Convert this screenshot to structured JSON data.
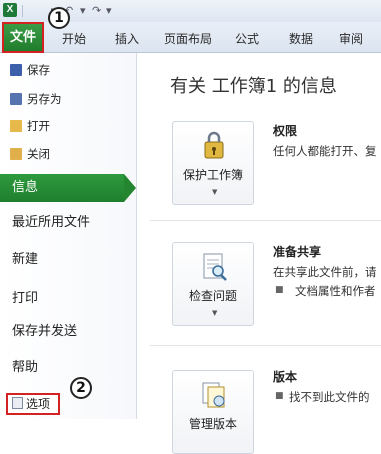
{
  "titlebar": {
    "app_icon_letter": "X",
    "qat_save": "▪",
    "qat_undo": "↶",
    "qat_redo": "↷",
    "qat_more": "▾"
  },
  "ribbon": {
    "file_tab": "文件",
    "tabs": [
      "开始",
      "插入",
      "页面布局",
      "公式",
      "数据",
      "审阅"
    ]
  },
  "callouts": [
    "1",
    "2"
  ],
  "nav": {
    "small_items": [
      "保存",
      "另存为",
      "打开",
      "关闭"
    ],
    "selected": "信息",
    "big_items": [
      "最近所用文件",
      "新建",
      "打印",
      "保存并发送",
      "帮助"
    ],
    "options": "选项"
  },
  "main": {
    "title": "有关 工作簿1 的信息",
    "sections": [
      {
        "button": "保护工作簿",
        "title": "权限",
        "text": "任何人都能打开、复"
      },
      {
        "button": "检查问题",
        "title": "准备共享",
        "text": "在共享此文件前，请",
        "bullet": "文档属性和作者"
      },
      {
        "button": "管理版本",
        "title": "版本",
        "bullet": "找不到此文件的"
      }
    ]
  },
  "colors": {
    "file_tab": "#2b8f39",
    "selected_nav": "#2b8f39",
    "highlight_border": "#d32222"
  }
}
